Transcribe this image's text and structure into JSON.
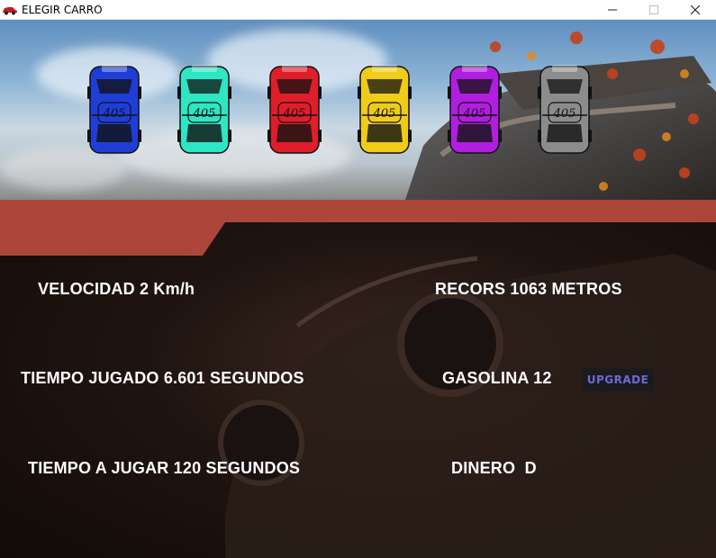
{
  "window": {
    "title": "ELEGIR CARRO",
    "controls": [
      "minimize",
      "maximize",
      "close"
    ]
  },
  "cars": [
    {
      "id": "car-blue",
      "color": "#1f3ed8"
    },
    {
      "id": "car-teal",
      "color": "#2ee6c4"
    },
    {
      "id": "car-red",
      "color": "#e01e2a"
    },
    {
      "id": "car-yellow",
      "color": "#f0cc1a"
    },
    {
      "id": "car-purple",
      "color": "#b11ee0"
    },
    {
      "id": "car-gray",
      "color": "#8c8c8c"
    }
  ],
  "car_badge": {
    "number": "405"
  },
  "stats": {
    "velocidad": "VELOCIDAD 2 Km/h",
    "recors": "RECORS 1063 METROS",
    "tiempo_jugado": "TIEMPO JUGADO 6.601 SEGUNDOS",
    "gasolina": "GASOLINA 12",
    "tiempo_a_jugar": "TIEMPO A JUGAR 120 SEGUNDOS",
    "dinero": "DINERO  D"
  },
  "buttons": {
    "upgrade_label": "UPGRADE"
  },
  "colors": {
    "accent_stripe": "#b44a3e",
    "upgrade_text": "#6b6bd6"
  }
}
